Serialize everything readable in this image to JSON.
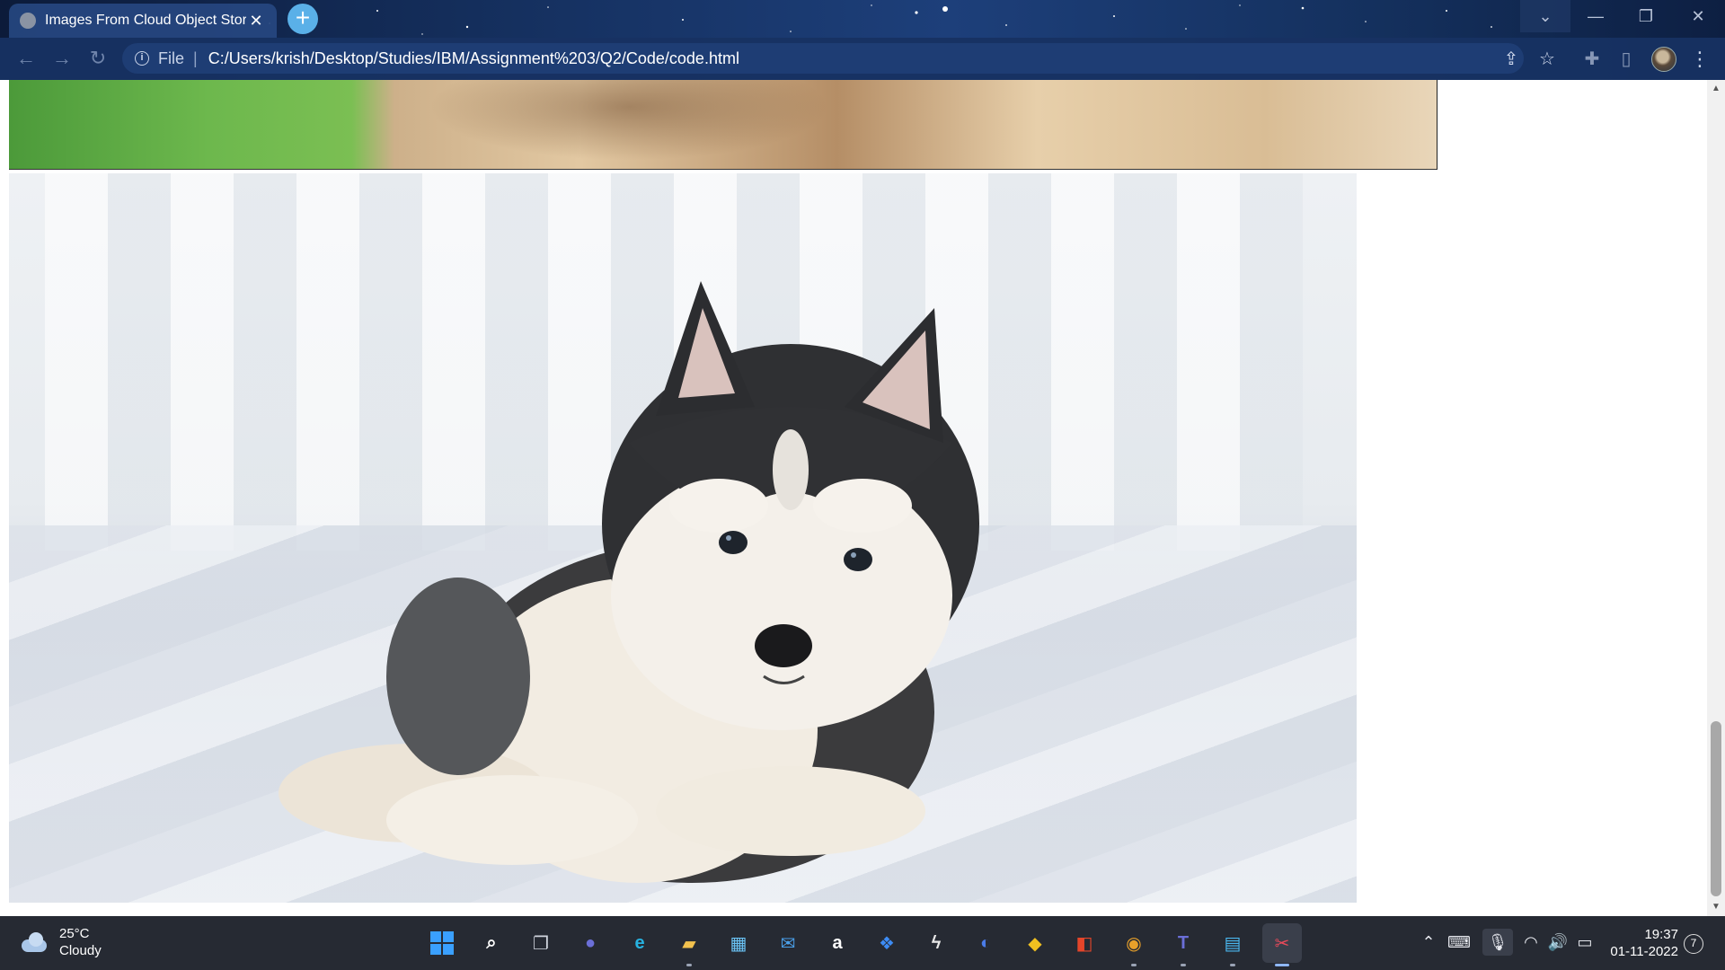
{
  "browser": {
    "tab_title": "Images From Cloud Object Stora",
    "tab_close": "✕",
    "new_tab": "+",
    "file_label": "File",
    "separator": "|",
    "url": "C:/Users/krish/Desktop/Studies/IBM/Assignment%203/Q2/Code/code.html",
    "window_controls": {
      "dropdown": "⌄",
      "minimize": "—",
      "maximize": "❐",
      "close": "✕"
    },
    "nav": {
      "back": "←",
      "forward": "→",
      "reload": "↻"
    },
    "icons": {
      "share": "⇪",
      "bookmark": "☆",
      "extensions": "✚",
      "sidebar": "▯",
      "menu": "⋮",
      "info": "i"
    }
  },
  "page": {
    "images": [
      {
        "name": "dog-image-partial"
      },
      {
        "name": "husky-puppy-image"
      }
    ],
    "scrollbar": {
      "up": "▲",
      "down": "▼",
      "scroll_position": 0.92
    }
  },
  "taskbar": {
    "weather": {
      "temp": "25°C",
      "condition": "Cloudy"
    },
    "apps": [
      {
        "name": "start-icon",
        "glyph": "",
        "color": "#3aa0ff"
      },
      {
        "name": "search-icon",
        "glyph": "⌕",
        "color": "#ffffff"
      },
      {
        "name": "task-view-icon",
        "glyph": "❐",
        "color": "#d0d4de"
      },
      {
        "name": "chat-icon",
        "glyph": "●",
        "color": "#6b6fd8"
      },
      {
        "name": "edge-icon",
        "glyph": "e",
        "color": "#27b2e0"
      },
      {
        "name": "file-explorer-icon",
        "glyph": "▰",
        "color": "#f2c14e"
      },
      {
        "name": "store-icon",
        "glyph": "▦",
        "color": "#6ac3f5"
      },
      {
        "name": "mail-icon",
        "glyph": "✉",
        "color": "#4a9fe8"
      },
      {
        "name": "amazon-icon",
        "glyph": "a",
        "color": "#ffffff"
      },
      {
        "name": "dropbox-icon",
        "glyph": "❖",
        "color": "#3d8cf5"
      },
      {
        "name": "app-bolt-icon",
        "glyph": "ϟ",
        "color": "#e8e8e8"
      },
      {
        "name": "app-arc-icon",
        "glyph": "◐",
        "color": "#4a7ce8"
      },
      {
        "name": "app-coin-icon",
        "glyph": "◆",
        "color": "#f0c020"
      },
      {
        "name": "office-icon",
        "glyph": "◧",
        "color": "#e4452a"
      },
      {
        "name": "chrome-icon",
        "glyph": "◉",
        "color": "#e8a02a"
      },
      {
        "name": "teams-icon",
        "glyph": "T",
        "color": "#6b6fd8"
      },
      {
        "name": "notepad-icon",
        "glyph": "▤",
        "color": "#4ab8f0"
      },
      {
        "name": "snipping-icon",
        "glyph": "✂",
        "color": "#e84a5a"
      }
    ],
    "tray": {
      "chevron": "⌃",
      "keyboard": "⌨",
      "mic_muted": "🎙",
      "wifi": "◠",
      "volume": "🔊",
      "battery": "▭"
    },
    "time": "19:37",
    "date": "01-11-2022",
    "notifications": "7"
  }
}
